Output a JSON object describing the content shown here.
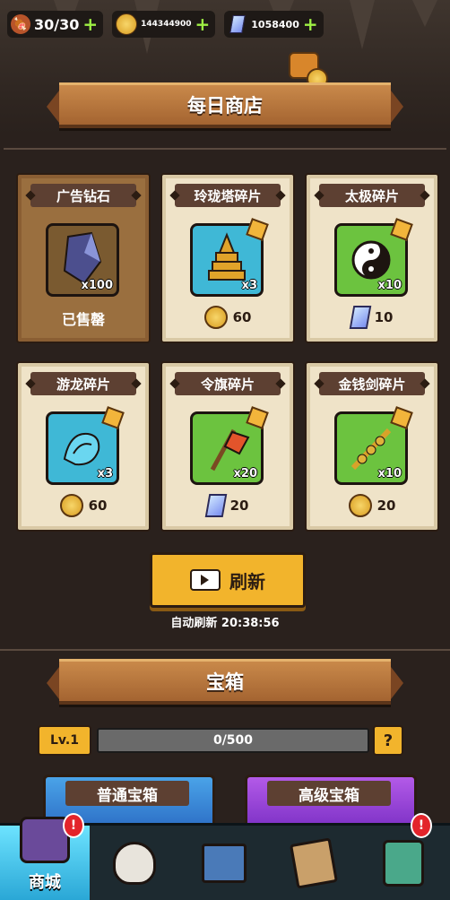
{
  "resources": {
    "stamina": "30/30",
    "gold": "144344900",
    "gems": "1058400",
    "plus": "+"
  },
  "daily_shop": {
    "title": "每日商店",
    "items": [
      {
        "name": "广告钻石",
        "qty": "x100",
        "status": "已售罄",
        "icon": "crystal-icon"
      },
      {
        "name": "玲珑塔碎片",
        "qty": "x3",
        "price": "60",
        "currency": "coin",
        "icon": "pagoda-icon"
      },
      {
        "name": "太极碎片",
        "qty": "x10",
        "price": "10",
        "currency": "gem",
        "icon": "taiji-icon"
      },
      {
        "name": "游龙碎片",
        "qty": "x3",
        "price": "60",
        "currency": "coin",
        "icon": "dragon-icon"
      },
      {
        "name": "令旗碎片",
        "qty": "x20",
        "price": "20",
        "currency": "gem",
        "icon": "flag-icon"
      },
      {
        "name": "金钱剑碎片",
        "qty": "x10",
        "price": "20",
        "currency": "coin",
        "icon": "coin-sword-icon"
      }
    ],
    "refresh_label": "刷新",
    "auto_refresh": "自动刷新 20:38:56"
  },
  "chest": {
    "title": "宝箱",
    "level": "Lv.1",
    "progress_text": "0/500",
    "progress_fraction": 0,
    "help": "?",
    "normal": "普通宝箱",
    "advanced": "高级宝箱"
  },
  "tabs": {
    "shop": "商城"
  },
  "colors": {
    "accent": "#f2b42c",
    "banner": "#b87640",
    "card": "#efe3c8",
    "active_tab": "#4cc6ee"
  }
}
